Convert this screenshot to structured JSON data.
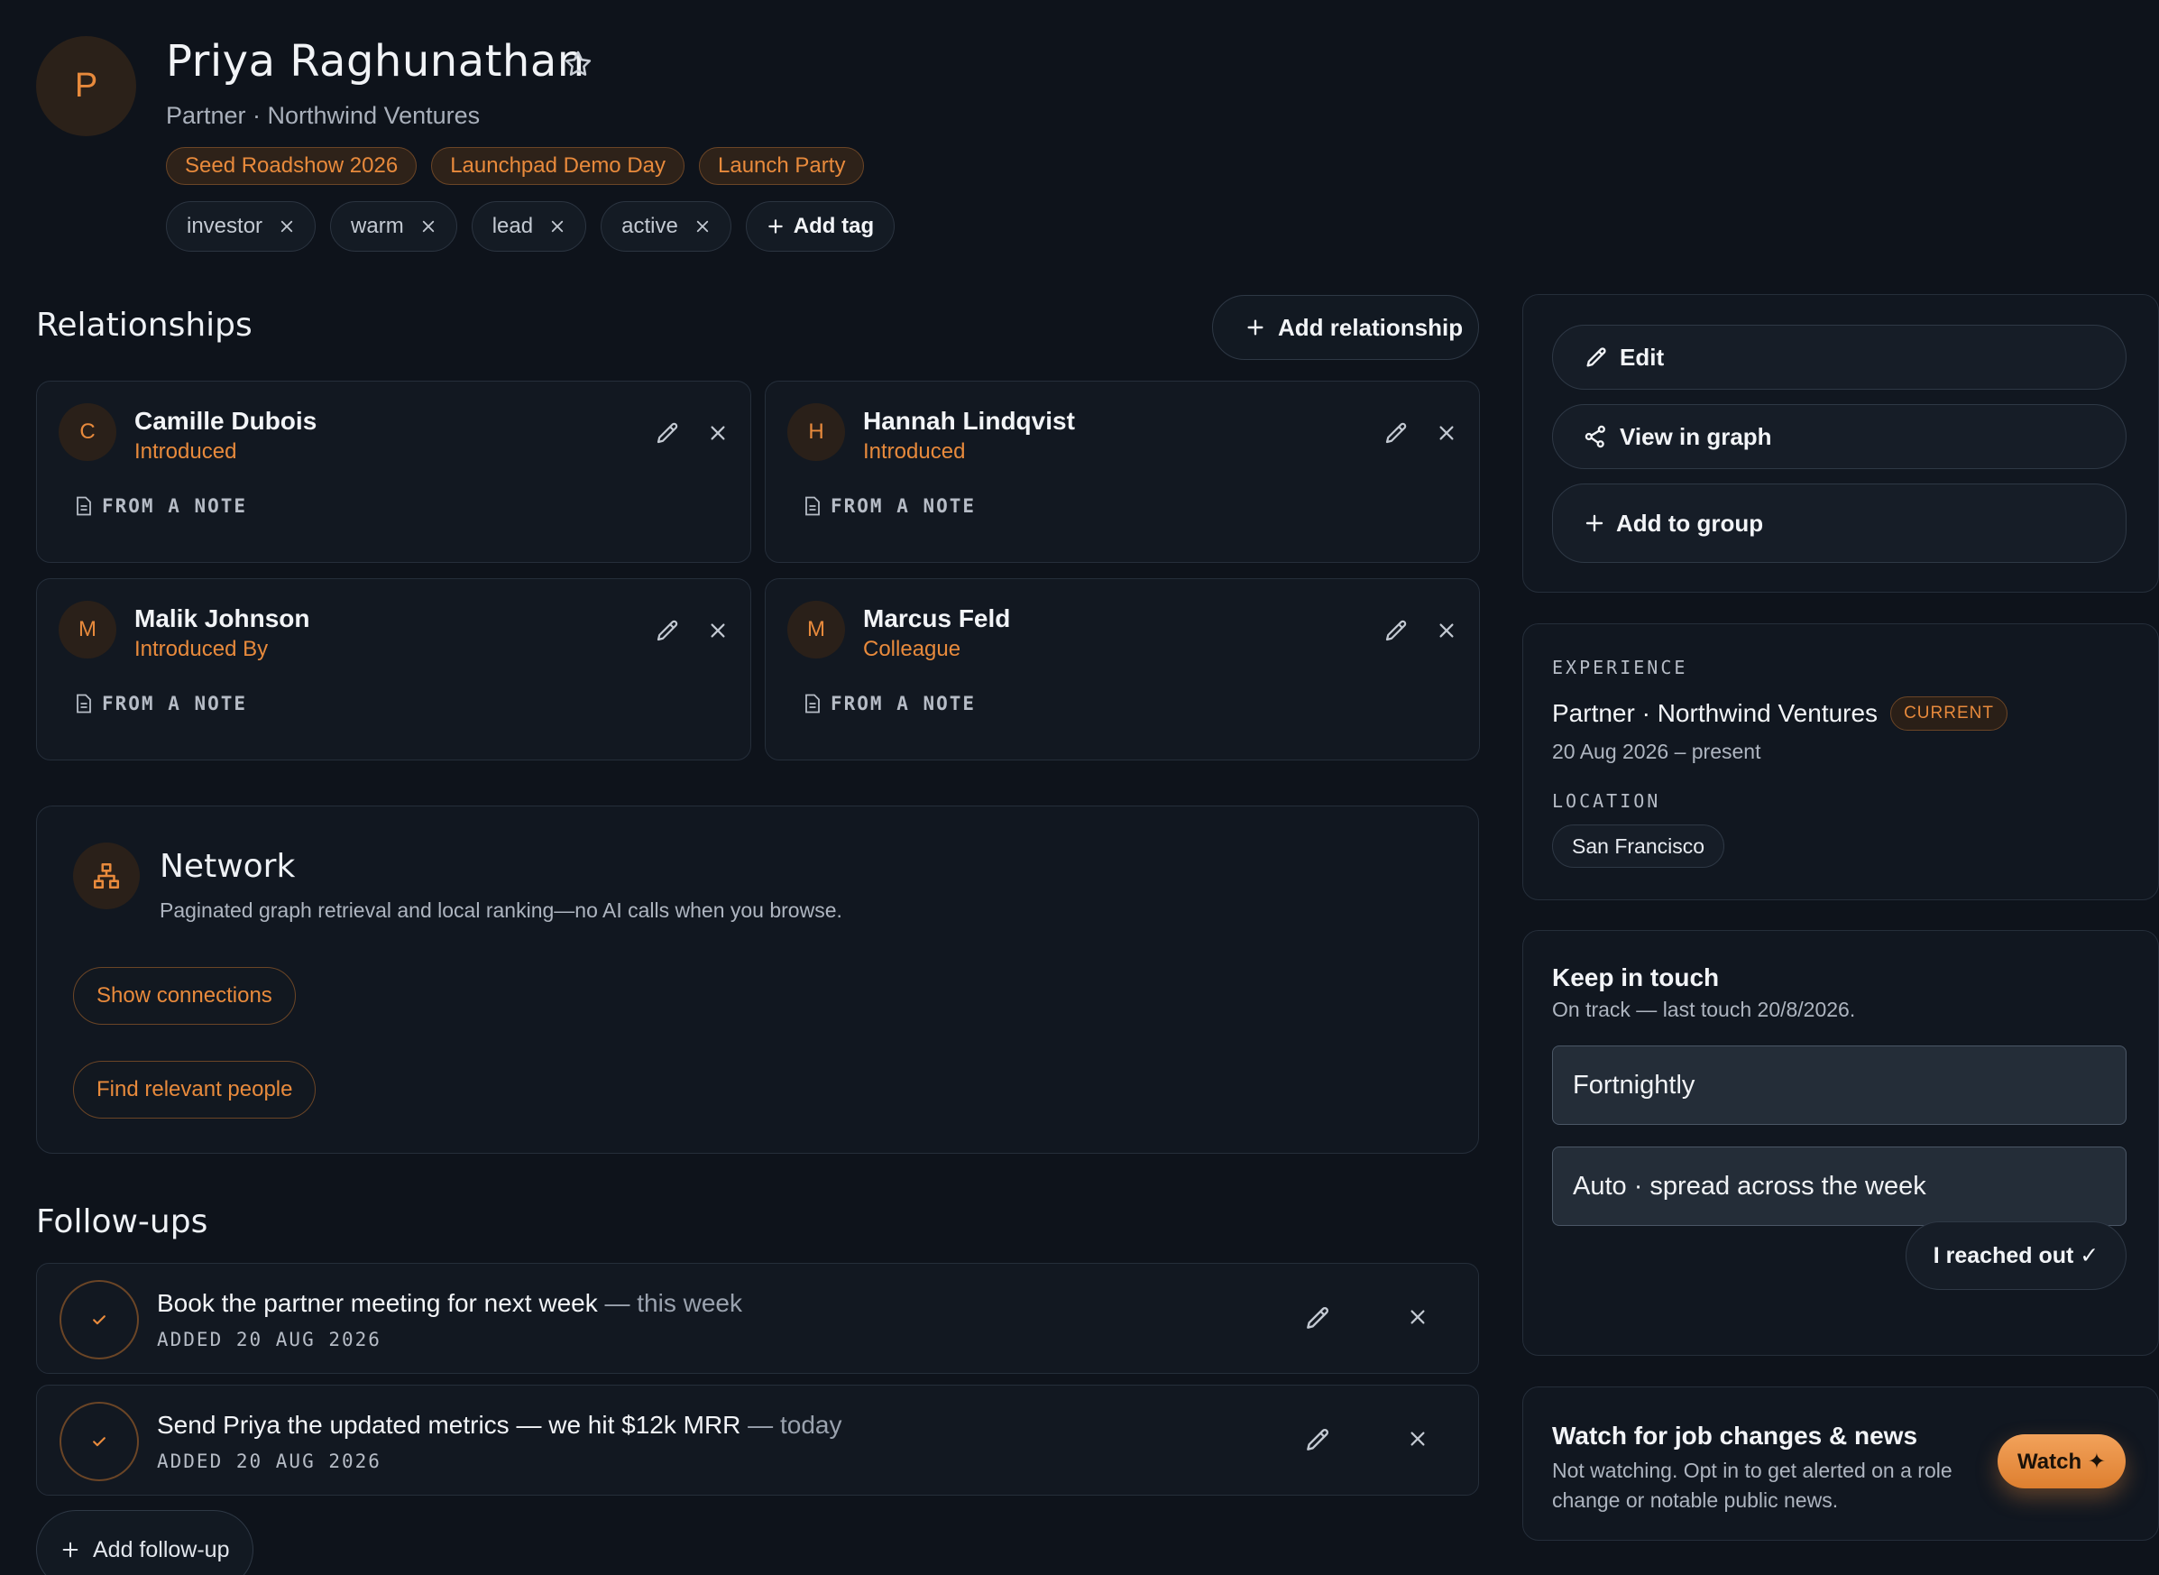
{
  "contact": {
    "initial": "P",
    "name": "Priya Raghunathan",
    "subtitle": "Partner · Northwind Ventures",
    "groups": [
      "Seed Roadshow 2026",
      "Launchpad Demo Day",
      "Launch Party"
    ],
    "tags": [
      "investor",
      "warm",
      "lead",
      "active"
    ],
    "add_tag_label": "Add tag"
  },
  "relationships": {
    "title": "Relationships",
    "add_label": "Add relationship",
    "items": [
      {
        "initial": "C",
        "name": "Camille Dubois",
        "type": "Introduced",
        "source": "FROM A NOTE"
      },
      {
        "initial": "H",
        "name": "Hannah Lindqvist",
        "type": "Introduced",
        "source": "FROM A NOTE"
      },
      {
        "initial": "M",
        "name": "Malik Johnson",
        "type": "Introduced By",
        "source": "FROM A NOTE"
      },
      {
        "initial": "M",
        "name": "Marcus Feld",
        "type": "Colleague",
        "source": "FROM A NOTE"
      }
    ]
  },
  "network": {
    "title": "Network",
    "description": "Paginated graph retrieval and local ranking—no AI calls when you browse.",
    "show_connections_label": "Show connections",
    "find_people_label": "Find relevant people"
  },
  "followups": {
    "title": "Follow-ups",
    "items": [
      {
        "text": "Book the partner meeting for next week",
        "when": " — this week",
        "added": "ADDED 20 AUG 2026"
      },
      {
        "text": "Send Priya the updated metrics — we hit $12k MRR",
        "when": " — today",
        "added": "ADDED 20 AUG 2026"
      }
    ],
    "add_label": "Add follow-up"
  },
  "actions": {
    "edit_label": "Edit",
    "graph_label": "View in graph",
    "group_label": "Add to group"
  },
  "experience": {
    "label": "EXPERIENCE",
    "title": "Partner · Northwind Ventures",
    "badge": "CURRENT",
    "range": "20 Aug 2026 – present",
    "location_label": "LOCATION",
    "location": "San Francisco"
  },
  "keep_in_touch": {
    "title": "Keep in touch",
    "status": "On track — last touch 20/8/2026.",
    "cadence": "Fortnightly",
    "scheduling": "Auto · spread across the week",
    "reached_out_label": "I reached out ✓"
  },
  "watch": {
    "title": "Watch for job changes & news",
    "description": "Not watching. Opt in to get alerted on a role change or notable public news.",
    "button_label": "Watch ✦"
  },
  "colors": {
    "background": "#0e131b",
    "accent": "#e88a3c",
    "card": "#121821",
    "border": "#252e3a"
  },
  "icons": [
    "star-icon",
    "close-icon",
    "plus-icon",
    "pencil-icon",
    "note-icon",
    "network-icon",
    "check-icon",
    "graph-icon"
  ]
}
